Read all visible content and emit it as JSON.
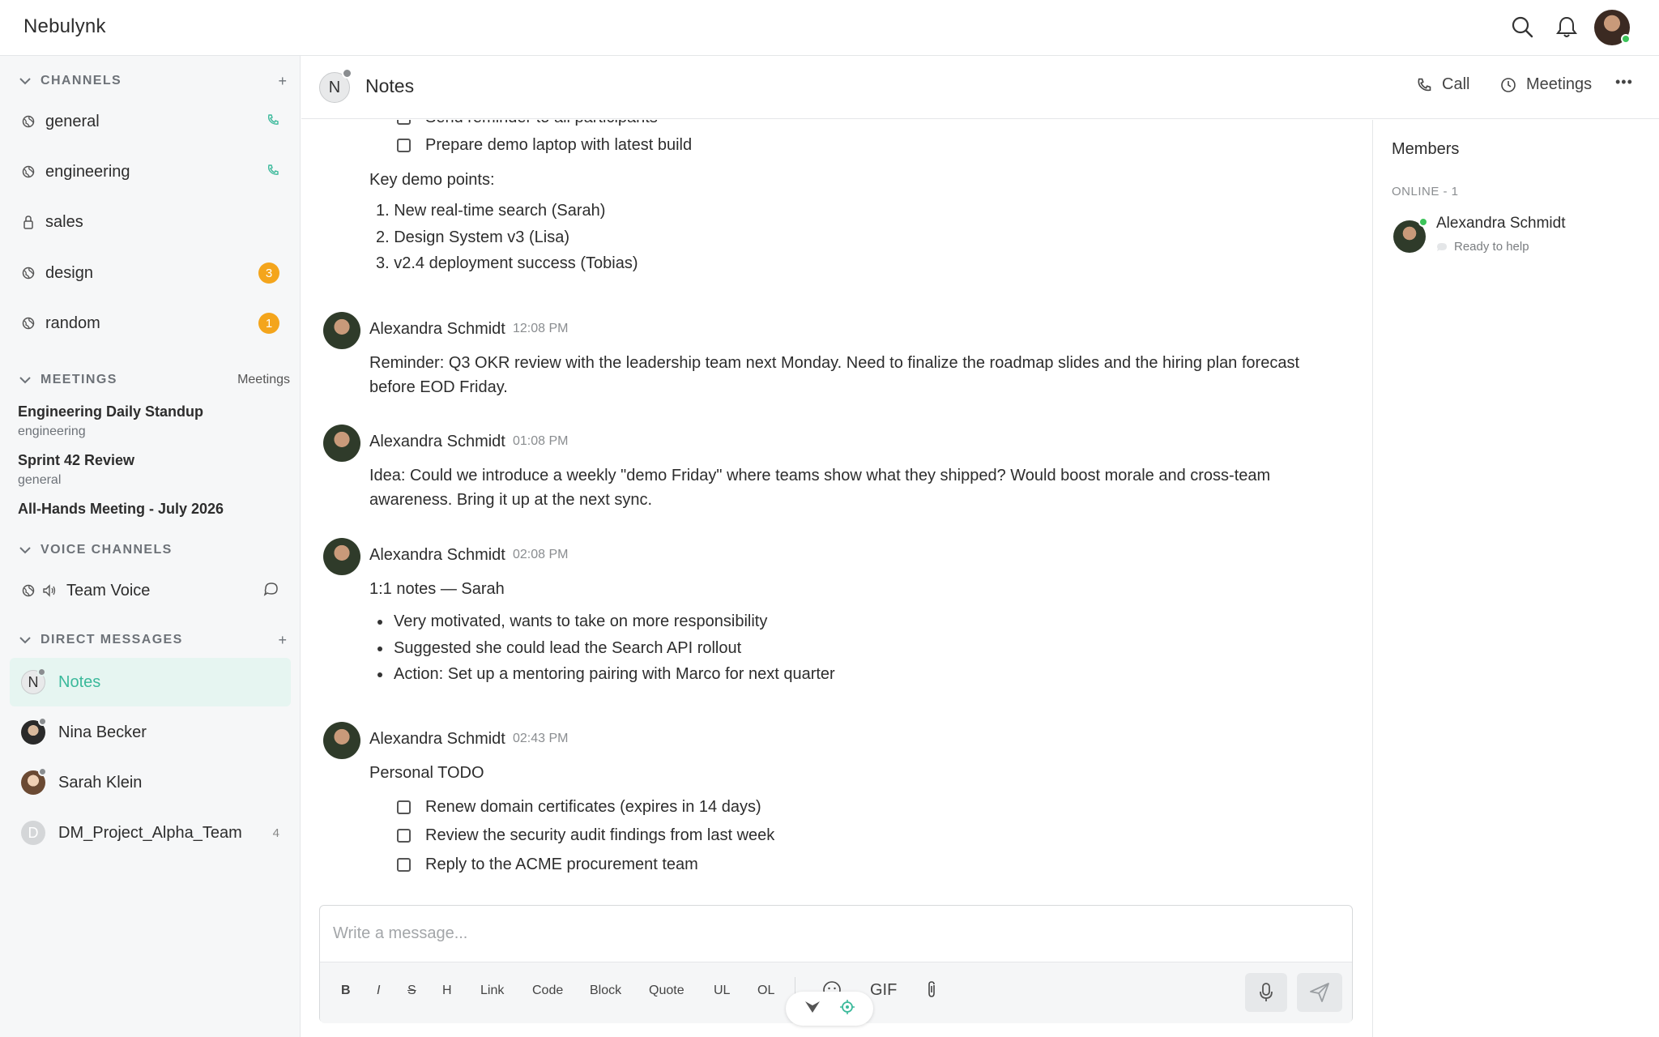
{
  "app": {
    "brand": "Nebulynk"
  },
  "sidebar": {
    "channels_title": "CHANNELS",
    "channels_add": "+",
    "channels": [
      {
        "label": "general",
        "icon": "globe-icon",
        "call": true
      },
      {
        "label": "engineering",
        "icon": "globe-icon",
        "call": true
      },
      {
        "label": "sales",
        "icon": "lock-icon"
      },
      {
        "label": "design",
        "icon": "globe-icon",
        "badge": "3"
      },
      {
        "label": "random",
        "icon": "globe-icon",
        "badge": "1"
      }
    ],
    "meetings_title": "MEETINGS",
    "meetings_link": "Meetings",
    "meetings": [
      {
        "title": "Engineering Daily Standup",
        "sub": "engineering"
      },
      {
        "title": "Sprint 42 Review",
        "sub": "general"
      },
      {
        "title": "All-Hands Meeting - July 2026"
      }
    ],
    "voice_title": "VOICE CHANNELS",
    "voice": [
      {
        "label": "Team Voice"
      }
    ],
    "dm_title": "DIRECT MESSAGES",
    "dm_add": "+",
    "dms": [
      {
        "label": "Notes",
        "initial": "N",
        "active": true
      },
      {
        "label": "Nina Becker"
      },
      {
        "label": "Sarah Klein"
      },
      {
        "label": "DM_Project_Alpha_Team",
        "initial": "D",
        "count": "4"
      }
    ]
  },
  "channel": {
    "initial": "N",
    "title": "Notes",
    "call_label": "Call",
    "meetings_label": "Meetings",
    "more": "•••"
  },
  "messages": {
    "partial_checkbox": "Send reminder to all participants",
    "prep_checkbox": "Prepare demo laptop with latest build",
    "key_points_title": "Key demo points:",
    "key_points": [
      "1. New real-time search (Sarah)",
      "2. Design System v3 (Lisa)",
      "3. v2.4 deployment success (Tobias)"
    ],
    "items": [
      {
        "author": "Alexandra Schmidt",
        "time": "12:08 PM",
        "text": "Reminder: Q3 OKR review with the leadership team next Monday. Need to finalize the roadmap slides and the hiring plan forecast before EOD Friday."
      },
      {
        "author": "Alexandra Schmidt",
        "time": "01:08 PM",
        "text": "Idea: Could we introduce a weekly \"demo Friday\" where teams show what they shipped? Would boost morale and cross-team awareness. Bring it up at the next sync."
      },
      {
        "author": "Alexandra Schmidt",
        "time": "02:08 PM",
        "text": "1:1 notes — Sarah",
        "bullets": [
          "Very motivated, wants to take on more responsibility",
          "Suggested she could lead the Search API rollout",
          "Action: Set up a mentoring pairing with Marco for next quarter"
        ]
      },
      {
        "author": "Alexandra Schmidt",
        "time": "02:43 PM",
        "text": "Personal TODO",
        "todos": [
          "Renew domain certificates (expires in 14 days)",
          "Review the security audit findings from last week",
          "Reply to the ACME procurement team"
        ]
      }
    ]
  },
  "members": {
    "title": "Members",
    "group": "ONLINE - 1",
    "list": [
      {
        "name": "Alexandra Schmidt",
        "status": "Ready to help"
      }
    ]
  },
  "composer": {
    "placeholder": "Write a message...",
    "tools": {
      "bold": "B",
      "italic": "I",
      "strike": "S",
      "heading": "H",
      "link": "Link",
      "code": "Code",
      "block": "Block",
      "quote": "Quote",
      "ul": "UL",
      "ol": "OL",
      "gif": "GIF"
    }
  },
  "colors": {
    "accent": "#3bb99b",
    "badge": "#f4a51c",
    "online": "#3cc45a",
    "away": "#8a8d90"
  }
}
